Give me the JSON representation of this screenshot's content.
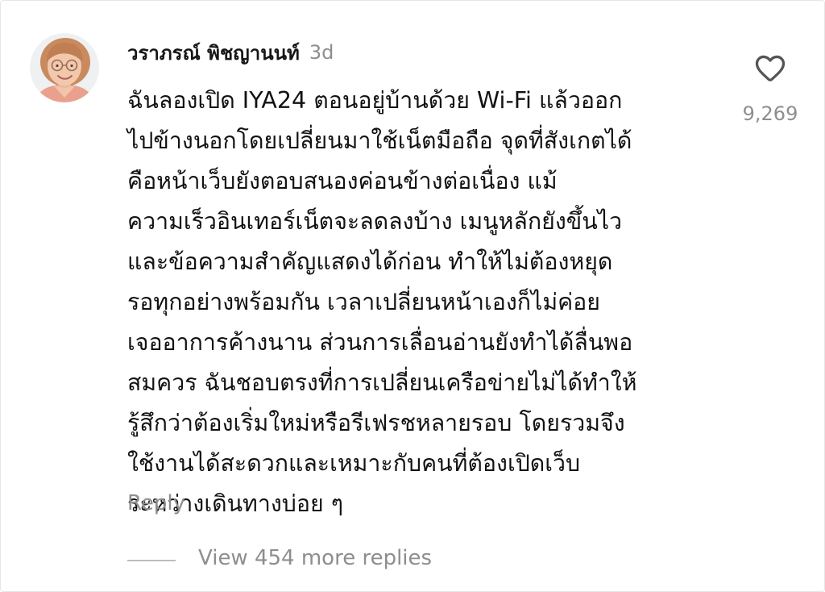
{
  "comment": {
    "username": "วราภรณ์ พิชญานนท์",
    "time_ago": "3d",
    "text_lines": [
      "ฉันลองเปิด IYA24 ตอนอยู่บ้านด้วย Wi-Fi แล้วออก",
      "ไปข้างนอกโดยเปลี่ยนมาใช้เน็ตมือถือ จุดที่สังเกตได้",
      "คือหน้าเว็บยังตอบสนองค่อนข้างต่อเนื่อง แม้",
      "ความเร็วอินเทอร์เน็ตจะลดลงบ้าง เมนูหลักยังขึ้นไว",
      "และข้อความสำคัญแสดงได้ก่อน ทำให้ไม่ต้องหยุด",
      "รอทุกอย่างพร้อมกัน เวลาเปลี่ยนหน้าเองก็ไม่ค่อย",
      "เจออาการค้างนาน ส่วนการเลื่อนอ่านยังทำได้ลื่นพอ",
      "สมควร ฉันชอบตรงที่การเปลี่ยนเครือข่ายไม่ได้ทำให้",
      "รู้สึกว่าต้องเริ่มใหม่หรือรีเฟรชหลายรอบ โดยรวมจึง",
      "ใช้งานได้สะดวกและเหมาะกับคนที่ต้องเปิดเว็บ",
      "ระหว่างเดินทางบ่อย ๆ"
    ],
    "reply_label": "Reply",
    "view_replies_label": "View 454 more replies",
    "like_count": "9,269",
    "icons": {
      "like": "heart-outline-icon",
      "avatar": "user-avatar"
    },
    "colors": {
      "text": "#121212",
      "muted": "#8e8e8e",
      "divider": "#bdbdbd"
    }
  }
}
